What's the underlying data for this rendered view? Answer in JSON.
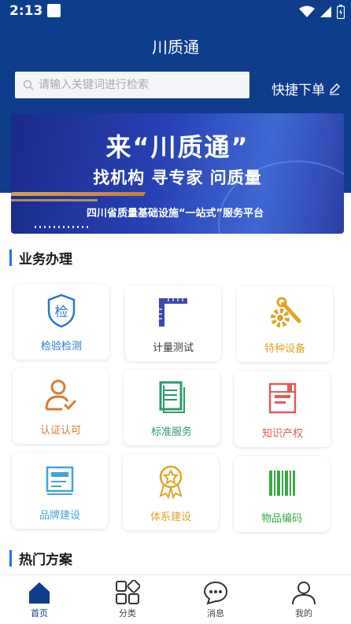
{
  "status_bar": {
    "time": "2:13"
  },
  "header": {
    "title": "川质通",
    "search_placeholder": "请输入关键词进行检索",
    "quick_order_label": "快捷下单"
  },
  "banner": {
    "title": "来“川质通”",
    "subtitle": "找机构 寻专家 问质量",
    "footer": "四川省质量基础设施“一站式”服务平台"
  },
  "business_section": {
    "title": "业务办理",
    "items": [
      {
        "label": "检验检测",
        "icon": "shield-check-icon",
        "color": "#2a74d6"
      },
      {
        "label": "计量测试",
        "icon": "ruler-icon",
        "color": "#3d49a8"
      },
      {
        "label": "特种设备",
        "icon": "gear-wrench-icon",
        "color": "#e0a528"
      },
      {
        "label": "认证认可",
        "icon": "user-check-icon",
        "color": "#d97d34"
      },
      {
        "label": "标准服务",
        "icon": "document-icon",
        "color": "#2c9a6a"
      },
      {
        "label": "知识产权",
        "icon": "book-icon",
        "color": "#e25b5b"
      },
      {
        "label": "品牌建设",
        "icon": "brand-board-icon",
        "color": "#3fa6d8"
      },
      {
        "label": "体系建设",
        "icon": "award-icon",
        "color": "#e0a528"
      },
      {
        "label": "物品编码",
        "icon": "barcode-icon",
        "color": "#3aa845"
      }
    ]
  },
  "hot_section": {
    "title": "热门方案"
  },
  "bottom_nav": {
    "items": [
      {
        "label": "首页",
        "icon": "home-icon"
      },
      {
        "label": "分类",
        "icon": "category-icon"
      },
      {
        "label": "消息",
        "icon": "message-icon"
      },
      {
        "label": "我的",
        "icon": "profile-icon"
      }
    ],
    "active_color": "#0e3d8c"
  },
  "colors": {
    "header_blue": "#0e3d8c",
    "accent": "#2a6df4"
  }
}
